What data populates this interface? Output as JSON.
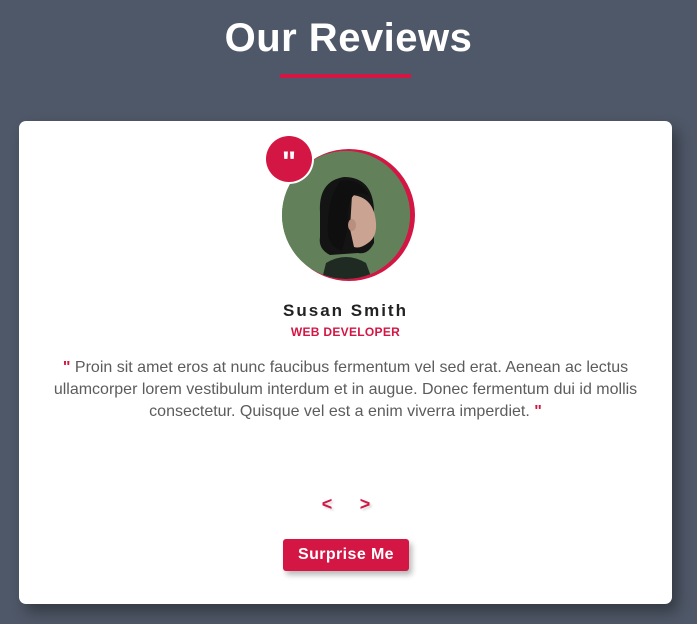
{
  "page": {
    "title": "Our Reviews"
  },
  "review": {
    "name": "Susan Smith",
    "job": "web developer",
    "quote_open": "\"",
    "text": " Proin sit amet eros at nunc faucibus fermentum vel sed erat. Aenean ac lectus ullamcorper lorem vestibulum interdum et in augue. Donec fermentum dui id mollis consectetur. Quisque vel est a enim viverra imperdiet. ",
    "quote_close": "\"",
    "badge_glyph": "\""
  },
  "controls": {
    "prev_label": "<",
    "next_label": ">",
    "surprise_label": "Surprise Me"
  },
  "icons": {
    "badge": "quote-icon",
    "prev": "chevron-left-icon",
    "next": "chevron-right-icon"
  },
  "colors": {
    "background": "#4f5868",
    "accent": "#d31643",
    "card": "#ffffff",
    "text": "#5c5c5c"
  }
}
